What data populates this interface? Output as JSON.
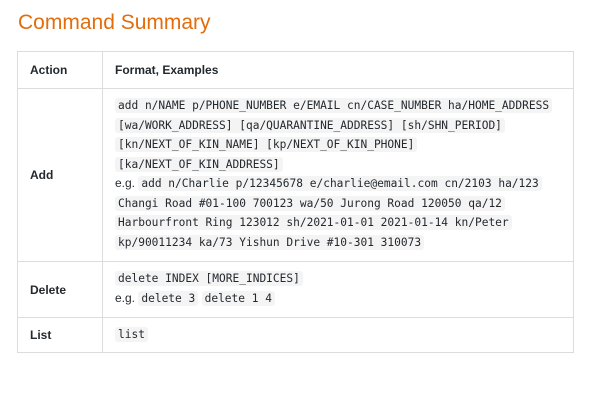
{
  "title": "Command Summary",
  "table": {
    "headers": {
      "action": "Action",
      "format": "Format, Examples"
    },
    "rows": {
      "add": {
        "action": "Add",
        "format": "add n/NAME p/PHONE_NUMBER e/EMAIL cn/CASE_NUMBER ha/HOME_ADDRESS [wa/WORK_ADDRESS] [qa/QUARANTINE_ADDRESS] [sh/SHN_PERIOD] [kn/NEXT_OF_KIN_NAME] [kp/NEXT_OF_KIN_PHONE] [ka/NEXT_OF_KIN_ADDRESS]",
        "eg_prefix": "e.g.",
        "example": "add n/Charlie p/12345678 e/charlie@email.com cn/2103 ha/123 Changi Road #01-100 700123 wa/50 Jurong Road 120050 qa/12 Harbourfront Ring 123012 sh/2021-01-01 2021-01-14 kn/Peter kp/90011234 ka/73 Yishun Drive #10-301 310073"
      },
      "delete": {
        "action": "Delete",
        "format": "delete INDEX [MORE_INDICES]",
        "eg_prefix": "e.g.",
        "examples": [
          "delete 3",
          "delete 1 4"
        ]
      },
      "list": {
        "action": "List",
        "format": "list"
      }
    }
  }
}
